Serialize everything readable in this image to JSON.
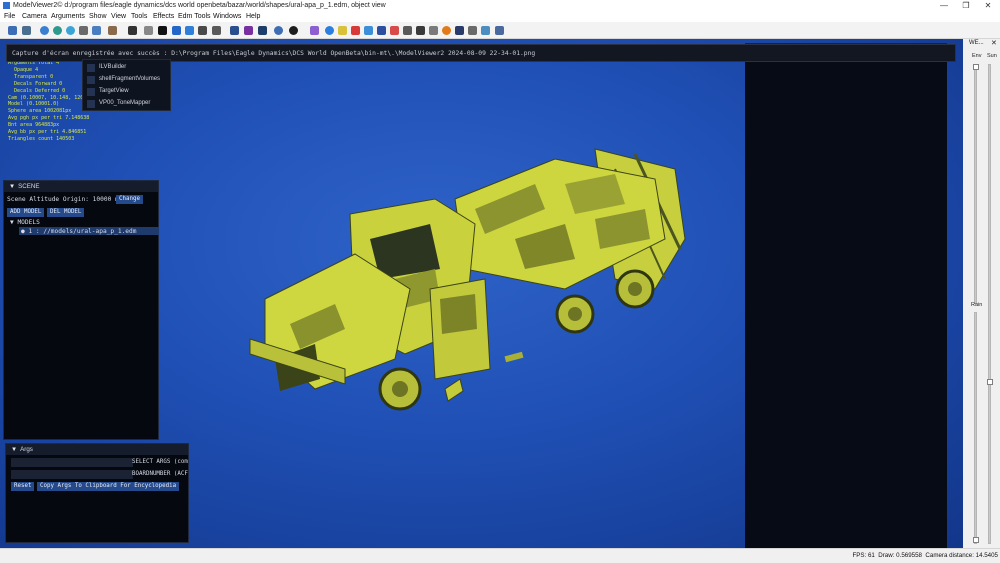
{
  "titlebar": {
    "title": "ModelViewer2© d:/program files/eagle dynamics/dcs world openbeta/bazar/world/shapes/ural-apa_p_1.edm, object view"
  },
  "menu": {
    "items": [
      "File",
      "Camera",
      "Arguments",
      "Show",
      "View",
      "Tools",
      "Effects",
      "Edm Tools",
      "Windows",
      "Help"
    ]
  },
  "notification": {
    "text": "Capture d'écran enregistrée avec succès : D:\\Program Files\\Eagle Dynamics\\DCS World OpenBeta\\bin-mt\\.\\ModelViewer2 2024-08-09 22-34-01.png"
  },
  "overlay_stats": [
    "Arguments Total 4",
    "Opaque 4",
    "Transparent 0",
    "Decals Forward 0",
    "Decals Deferred 0",
    "Cam (0.10007, 10.148, 120",
    "Model (0.10001.0)",
    "Sphere area 1002081px",
    "Avg pgh px per tri 7.148638",
    "Bnt area 964883px",
    "Avg bb px per tri 4.846851",
    "Triangles count 140503"
  ],
  "render_dropdown": {
    "items": [
      "ILVBuilder",
      "shellFragmentVolumes",
      "TargetView",
      "VP00_ToneMapper"
    ]
  },
  "scene_panel": {
    "title": "SCENE",
    "altitude_label": "Scene Altitude Origin: 10000 m",
    "change_label": "Change",
    "add_model": "ADD MODEL",
    "del_model": "DEL MODEL",
    "models_header": "MODELS",
    "model_item": "1 : //models/ural-apa_p_1.edm"
  },
  "args_panel": {
    "title": "Args",
    "select_args_label": "SELECT ARGS (com",
    "boardnumber_label": "BOARDNUMBER (ACF",
    "reset_label": "Reset",
    "copy_label": "Copy Args To Clipboard For Encyclopedia"
  },
  "right_sidebar": {
    "title": "WE...",
    "env_label": "Env",
    "sun_label": "Sun",
    "rain_label": "Rain"
  },
  "status": {
    "fps": "FPS: 61",
    "draw": "Draw: 0.569558",
    "camera": "Camera distance: 14.5405"
  },
  "colors": {
    "viewport": "#1f4fb4",
    "accent": "#244a8c",
    "truck": "#c7cf3f",
    "text_overlay": "#d8e840"
  }
}
